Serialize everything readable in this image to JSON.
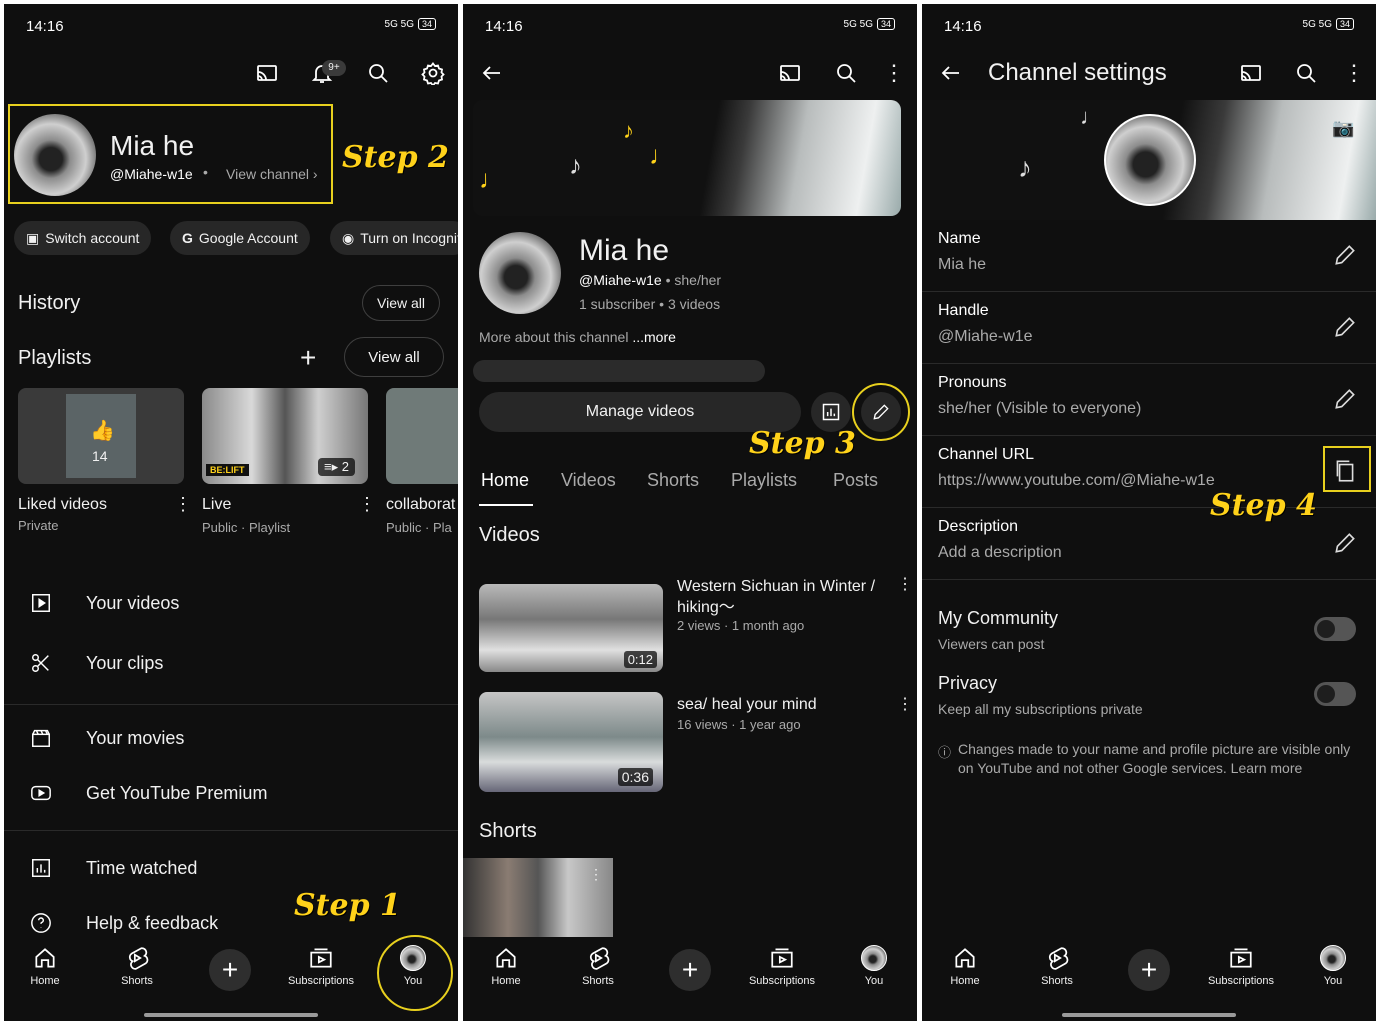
{
  "status": {
    "time": "14:16",
    "network": "5G 5G",
    "battery": "34"
  },
  "steps": {
    "s1": "Step 1",
    "s2": "Step 2",
    "s3": "Step 3",
    "s4": "Step 4"
  },
  "panel1": {
    "notif_badge": "9+",
    "profile": {
      "name": "Mia he",
      "handle": "@Miahe-w1e",
      "view_channel": "View channel"
    },
    "chips": [
      "Switch account",
      "Google Account",
      "Turn on Incognito"
    ],
    "history": {
      "title": "History",
      "view_all": "View all"
    },
    "playlists": {
      "title": "Playlists",
      "view_all": "View all",
      "items": [
        {
          "title": "Liked videos",
          "meta": "Private",
          "count": "14"
        },
        {
          "title": "Live",
          "meta": "Public · Playlist",
          "count": "2",
          "brand": "BE:LIFT"
        },
        {
          "title": "collaborat",
          "meta": "Public · Pla"
        }
      ]
    },
    "menu": [
      "Your videos",
      "Your clips",
      "Your movies",
      "Get YouTube Premium",
      "Time watched",
      "Help & feedback"
    ]
  },
  "panel2": {
    "channel": {
      "name": "Mia he",
      "handle": "@Miahe-w1e",
      "pronouns": "she/her",
      "subs": "1 subscriber",
      "videos": "3 videos"
    },
    "about": "More about this channel",
    "more": "...more",
    "manage_videos": "Manage videos",
    "tabs": [
      "Home",
      "Videos",
      "Shorts",
      "Playlists",
      "Posts"
    ],
    "videos_title": "Videos",
    "videos": [
      {
        "title": "Western Sichuan in Winter / hiking～",
        "meta": "2 views · 1 month ago",
        "duration": "0:12"
      },
      {
        "title": "sea/ heal your mind",
        "meta": "16 views · 1 year ago",
        "duration": "0:36"
      }
    ],
    "shorts_title": "Shorts"
  },
  "panel3": {
    "title": "Channel settings",
    "rows": [
      {
        "label": "Name",
        "value": "Mia he"
      },
      {
        "label": "Handle",
        "value": "@Miahe-w1e"
      },
      {
        "label": "Pronouns",
        "value": "she/her (Visible to everyone)"
      },
      {
        "label": "Channel URL",
        "value": "https://www.youtube.com/@Miahe-w1e"
      },
      {
        "label": "Description",
        "value": "Add a description"
      }
    ],
    "community": {
      "label": "My Community",
      "value": "Viewers can post"
    },
    "privacy": {
      "label": "Privacy",
      "value": "Keep all my subscriptions private"
    },
    "note": "Changes made to your name and profile picture are visible only on YouTube and not other Google services. Learn more"
  },
  "nav": [
    "Home",
    "Shorts",
    "Subscriptions",
    "You"
  ]
}
